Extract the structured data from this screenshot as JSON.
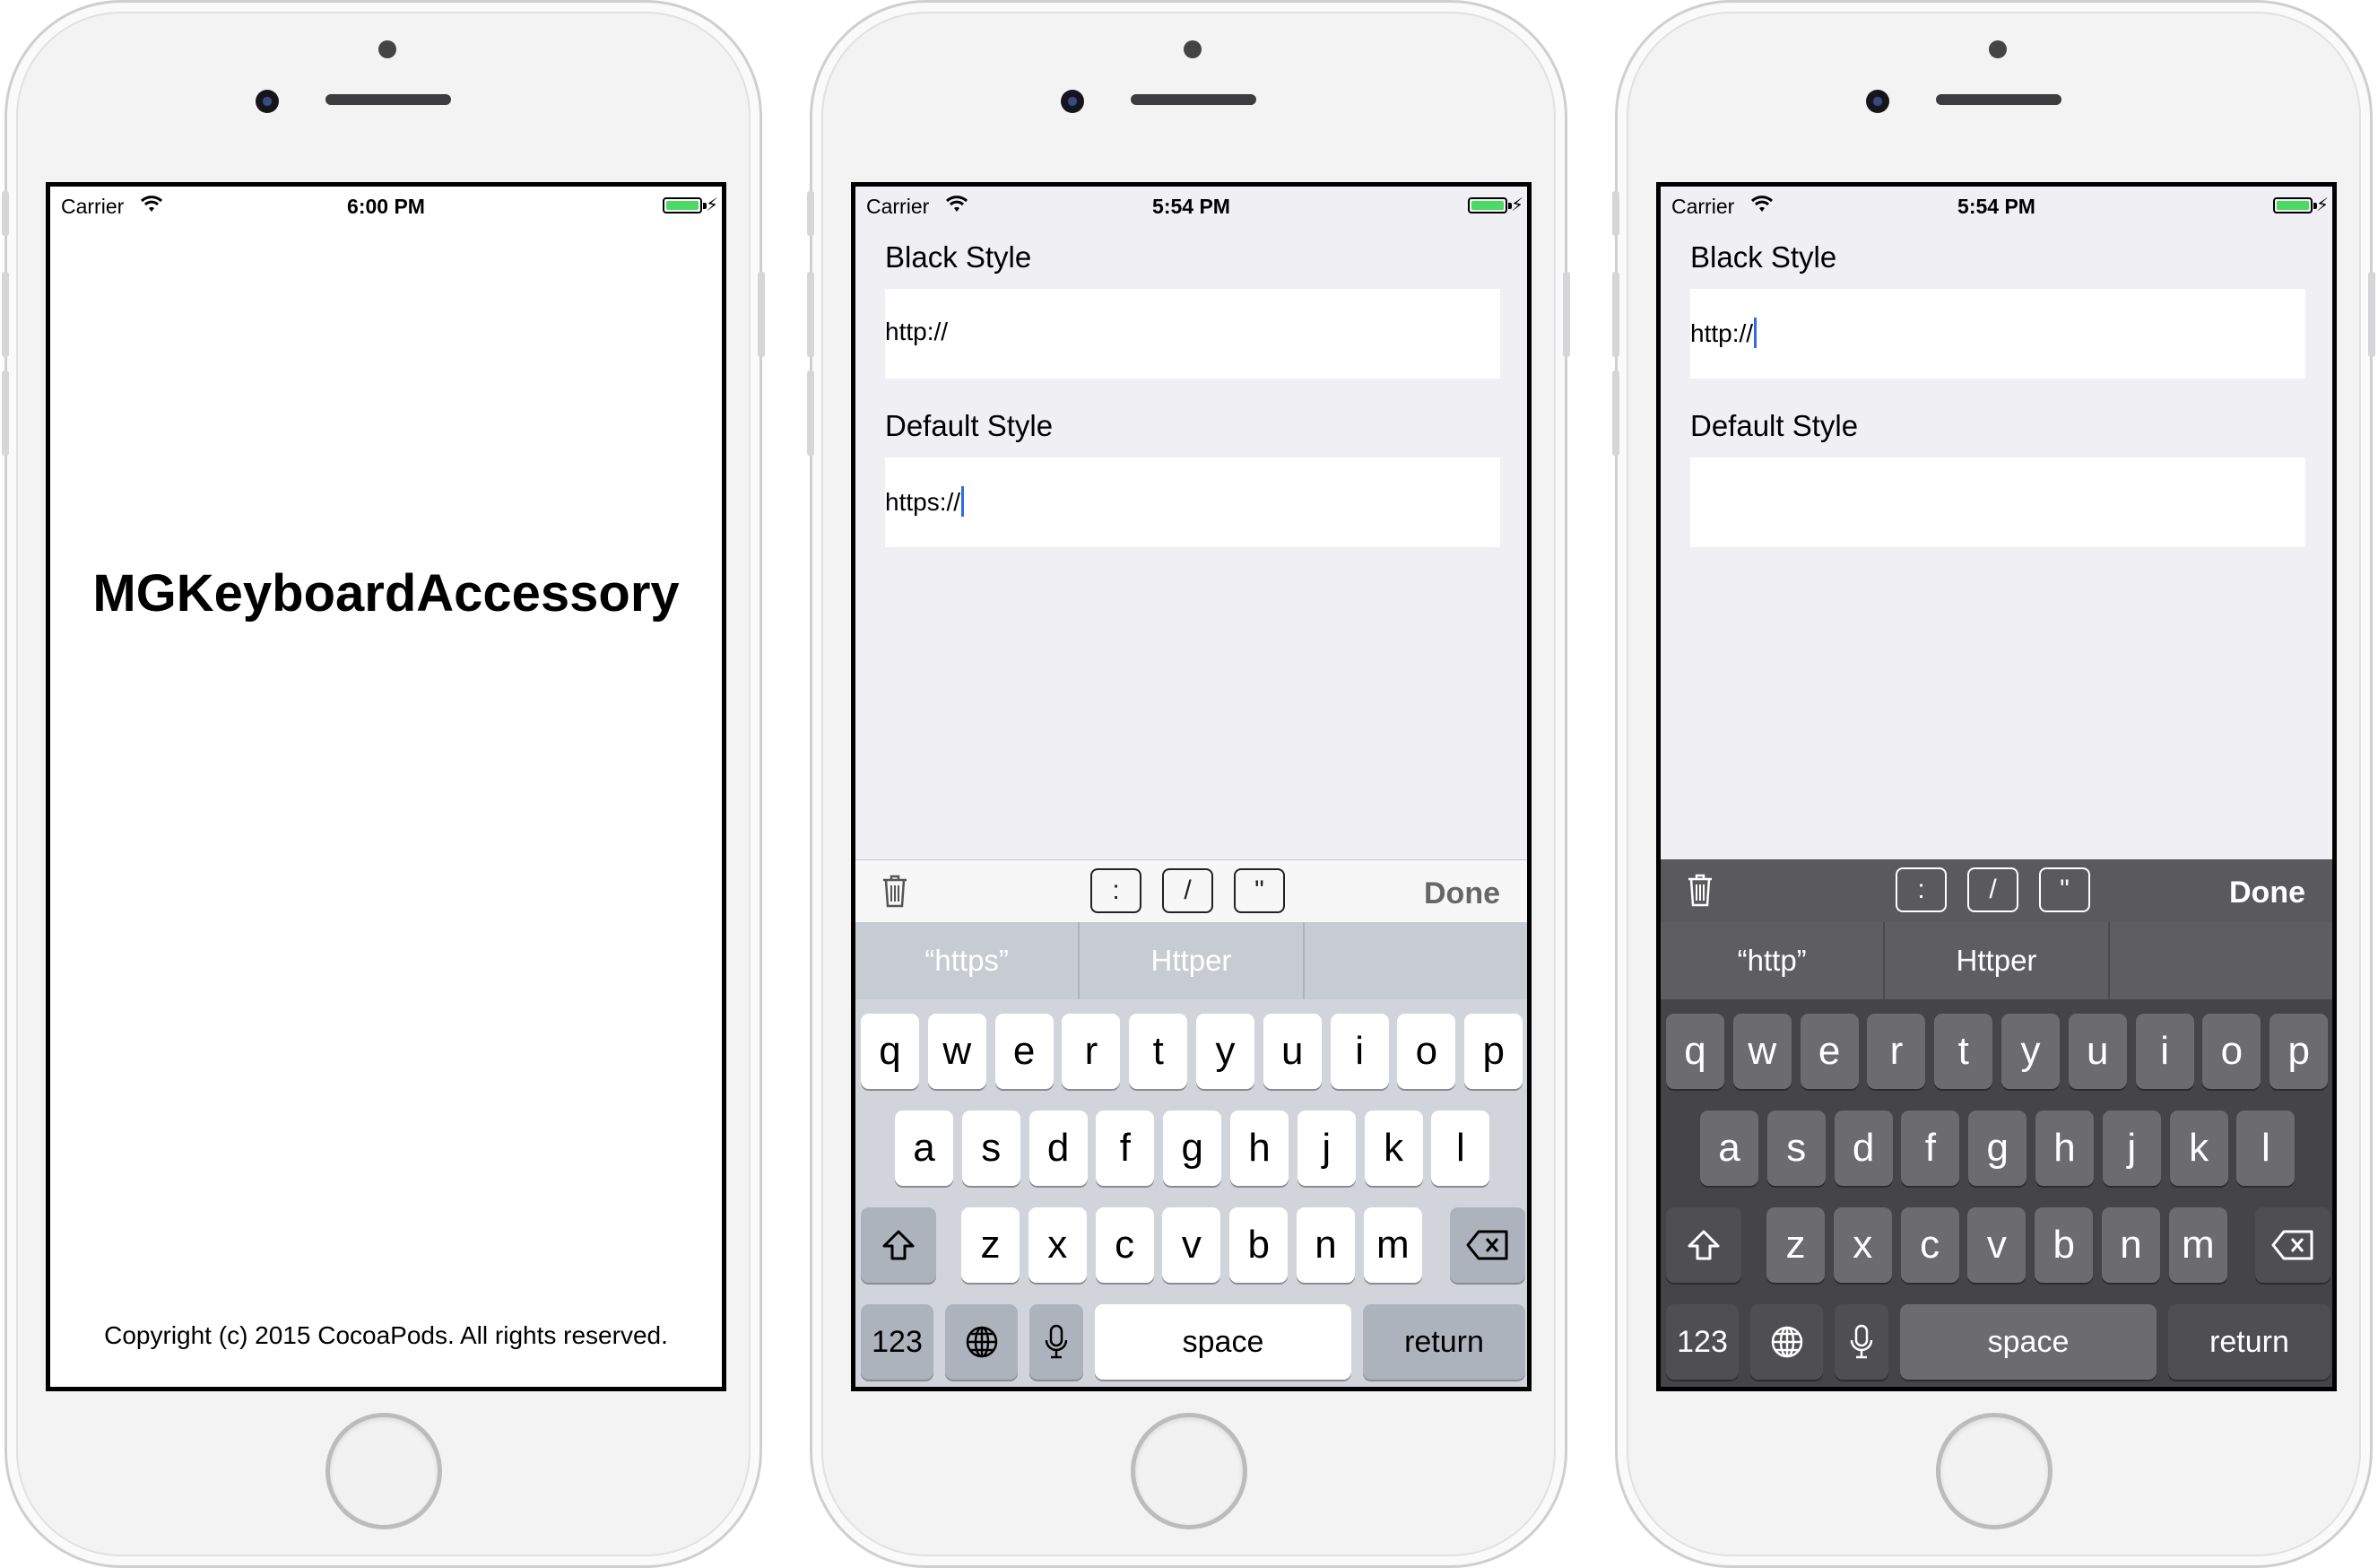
{
  "status_bar": {
    "carrier": "Carrier",
    "times": [
      "6:00 PM",
      "5:54 PM",
      "5:54 PM"
    ],
    "battery_color": "#4cd964"
  },
  "launch_screen": {
    "title": "MGKeyboardAccessory",
    "copyright": "Copyright (c) 2015 CocoaPods. All rights reserved."
  },
  "form": {
    "black_style_label": "Black Style",
    "default_style_label": "Default Style"
  },
  "screens": [
    {
      "black_value": "http://",
      "default_value": "https://",
      "focus": "default",
      "suggestions": [
        "“https”",
        "Httper",
        ""
      ]
    },
    {
      "black_value": "http://",
      "default_value": "",
      "focus": "black",
      "suggestions": [
        "“http”",
        "Httper",
        ""
      ]
    }
  ],
  "accessory": {
    "keys": [
      ":",
      "/",
      "\""
    ],
    "done_label": "Done",
    "trash_icon": "trash-icon"
  },
  "keyboard": {
    "row1": [
      "q",
      "w",
      "e",
      "r",
      "t",
      "y",
      "u",
      "i",
      "o",
      "p"
    ],
    "row2": [
      "a",
      "s",
      "d",
      "f",
      "g",
      "h",
      "j",
      "k",
      "l"
    ],
    "row3": [
      "z",
      "x",
      "c",
      "v",
      "b",
      "n",
      "m"
    ],
    "numbers_label": "123",
    "space_label": "space",
    "return_label": "return"
  },
  "colors": {
    "caret": "#2d6de2",
    "accessory_dark": "#5a5a5c",
    "keyboard_dark": "#454547"
  }
}
